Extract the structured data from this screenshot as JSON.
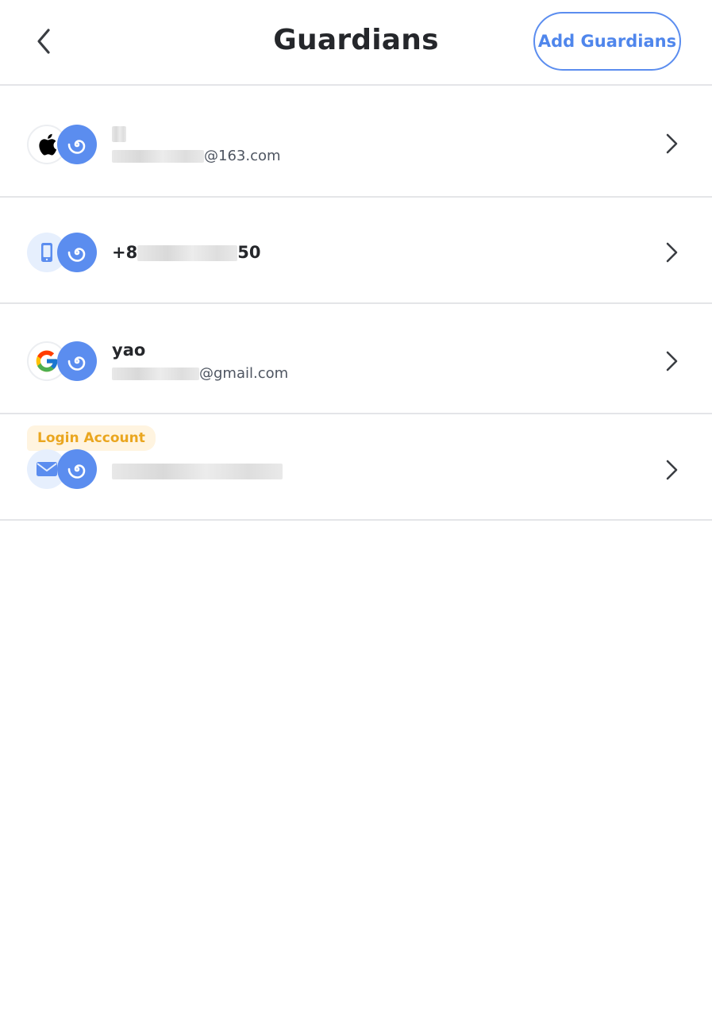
{
  "header": {
    "title": "Guardians",
    "add_label": "Add Guardians",
    "back_icon": "chevron-left-icon"
  },
  "colors": {
    "accent": "#5b8def",
    "badge_text": "#eaa61f",
    "badge_bg": "#fff4e0",
    "divider": "#e4e5e8"
  },
  "guardians": [
    {
      "type_icon": "apple-icon",
      "portkey_icon": "portkey-spiral-icon",
      "name": "",
      "email_suffix": "@163.com"
    },
    {
      "type_icon": "phone-icon",
      "portkey_icon": "portkey-spiral-icon",
      "phone_prefix": "+8",
      "phone_suffix": "50"
    },
    {
      "type_icon": "google-icon",
      "portkey_icon": "portkey-spiral-icon",
      "name": "yao",
      "email_suffix": "@gmail.com"
    },
    {
      "badge": "Login Account",
      "type_icon": "email-icon",
      "portkey_icon": "portkey-spiral-icon",
      "email": ""
    }
  ]
}
